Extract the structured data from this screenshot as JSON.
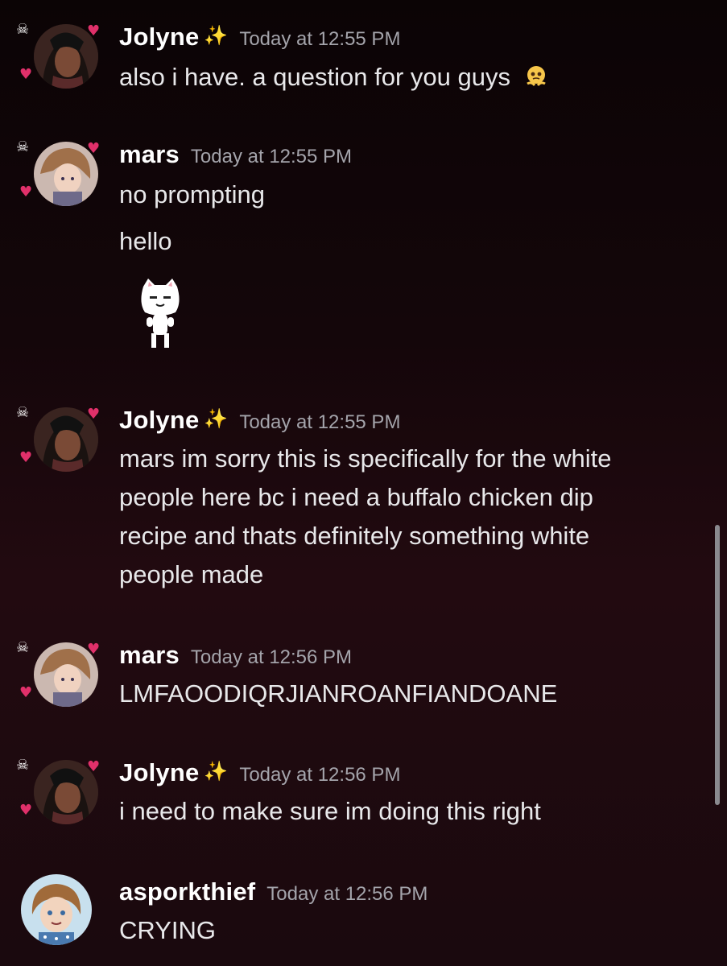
{
  "messages": [
    {
      "user": "Jolyne",
      "decoration": "sparkles",
      "time": "Today at 12:55 PM",
      "avatar": "jolyne-avatar",
      "lines": [
        "also i have. a question for you guys"
      ],
      "inline_emoji": "pleading-face-emoji"
    },
    {
      "user": "mars",
      "time": "Today at 12:55 PM",
      "avatar": "mars-avatar",
      "lines": [
        "no prompting",
        "hello"
      ],
      "sticker": "toro-cat-sticker"
    },
    {
      "user": "Jolyne",
      "decoration": "sparkles",
      "time": "Today at 12:55 PM",
      "avatar": "jolyne-avatar",
      "lines": [
        "mars im sorry this is specifically for the white",
        "people here bc i need a buffalo chicken dip",
        "recipe and thats definitely something white",
        "people made"
      ]
    },
    {
      "user": "mars",
      "time": "Today at 12:56 PM",
      "avatar": "mars-avatar",
      "lines": [
        "LMFAOODIQRJIANROANFIANDOANE"
      ]
    },
    {
      "user": "Jolyne",
      "decoration": "sparkles",
      "time": "Today at 12:56 PM",
      "avatar": "jolyne-avatar",
      "lines": [
        "i need to make sure im doing this right"
      ]
    },
    {
      "user": "asporkthief",
      "time": "Today at 12:56 PM",
      "avatar": "asporkthief-avatar",
      "lines": [
        "CRYING"
      ]
    }
  ],
  "colors": {
    "username": "#ffffff",
    "timestamp": "#a4a4ab",
    "text": "#e8e8ea",
    "heart": "#e0306a",
    "sparkle": "#f7d54a"
  }
}
